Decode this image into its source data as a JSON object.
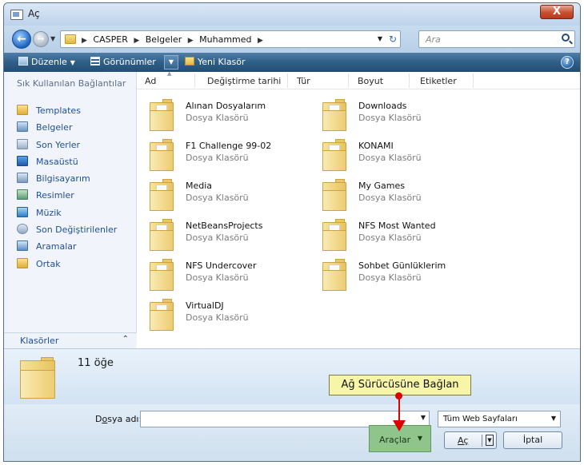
{
  "window": {
    "title": "Aç",
    "close_glyph": "X"
  },
  "address": {
    "breadcrumbs": [
      "CASPER",
      "Belgeler",
      "Muhammed"
    ],
    "search_placeholder": "Ara"
  },
  "toolbar": {
    "organize_label": "Düzenle",
    "views_label": "Görünümler",
    "new_folder_label": "Yeni Klasör",
    "help_glyph": "?"
  },
  "nav": {
    "header": "Sık Kullanılan Bağlantılar",
    "items": [
      {
        "label": "Templates",
        "icon": "folder-icon"
      },
      {
        "label": "Belgeler",
        "icon": "documents-icon"
      },
      {
        "label": "Son Yerler",
        "icon": "recent-places-icon"
      },
      {
        "label": "Masaüstü",
        "icon": "desktop-icon"
      },
      {
        "label": "Bilgisayarım",
        "icon": "computer-icon"
      },
      {
        "label": "Resimler",
        "icon": "pictures-icon"
      },
      {
        "label": "Müzik",
        "icon": "music-icon"
      },
      {
        "label": "Son Değiştirilenler",
        "icon": "recently-changed-icon"
      },
      {
        "label": "Aramalar",
        "icon": "searches-icon"
      },
      {
        "label": "Ortak",
        "icon": "folder-icon"
      }
    ],
    "folders_label": "Klasörler"
  },
  "columns": [
    "Ad",
    "Değiştirme tarihi",
    "Tür",
    "Boyut",
    "Etiketler"
  ],
  "files": [
    {
      "name": "Alınan Dosyalarım",
      "type": "Dosya Klasörü"
    },
    {
      "name": "Downloads",
      "type": "Dosya Klasörü"
    },
    {
      "name": "F1 Challenge 99-02",
      "type": "Dosya Klasörü"
    },
    {
      "name": "KONAMI",
      "type": "Dosya Klasörü"
    },
    {
      "name": "Media",
      "type": "Dosya Klasörü"
    },
    {
      "name": "My Games",
      "type": "Dosya Klasörü"
    },
    {
      "name": "NetBeansProjects",
      "type": "Dosya Klasörü"
    },
    {
      "name": "NFS Most Wanted",
      "type": "Dosya Klasörü"
    },
    {
      "name": "NFS Undercover",
      "type": "Dosya Klasörü"
    },
    {
      "name": "Sohbet Günlüklerim",
      "type": "Dosya Klasörü"
    },
    {
      "name": "VirtualDJ",
      "type": "Dosya Klasörü"
    }
  ],
  "details": {
    "count_text": "11 öğe"
  },
  "callout": {
    "text": "Ağ Sürücüsüne Bağlan",
    "color": "#dd0000"
  },
  "bottom": {
    "filename_label_prefix": "D",
    "filename_label_underlined": "o",
    "filename_label_suffix": "sya adı:",
    "filename_value": "",
    "filter_value": "Tüm Web Sayfaları",
    "tools_label": "Araçlar",
    "open_label": "Aç",
    "cancel_label": "İptal"
  },
  "colors": {
    "toolbar": "#2f5f87",
    "link": "#1f4f96",
    "tools_highlight": "#8fc48a",
    "callout_bg": "#f7f6a8"
  }
}
